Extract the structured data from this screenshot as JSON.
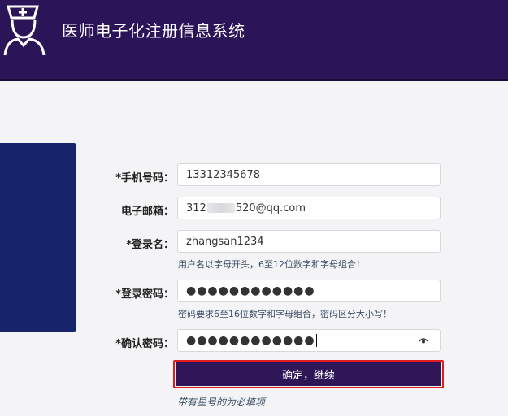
{
  "header": {
    "title": "医师电子化注册信息系统",
    "logo_icon": "nurse-doctor-icon"
  },
  "form": {
    "phone": {
      "label": "*手机号码：",
      "value": "13312345678"
    },
    "email": {
      "label": "电子邮箱：",
      "value_prefix": "312",
      "value_suffix": "520@qq.com"
    },
    "username": {
      "label": "*登录名：",
      "value": "zhangsan1234",
      "hint": "用户名以字母开头，6至12位数字和字母组合！"
    },
    "password": {
      "label": "*登录密码：",
      "value": "●●●●●●●●●●●●",
      "hint": "密码要求6至16位数字和字母组合，密码区分大小写！"
    },
    "confirm_password": {
      "label": "*确认密码：",
      "value": "●●●●●●●●●●●●",
      "toggle_icon": "eye-icon"
    },
    "submit_label": "确定，继续",
    "required_note": "带有星号的为必填项"
  },
  "colors": {
    "header_bg": "#2b1558",
    "side_panel": "#17236b",
    "button_bg": "#2f1657",
    "highlight_border": "#e01c1c"
  }
}
